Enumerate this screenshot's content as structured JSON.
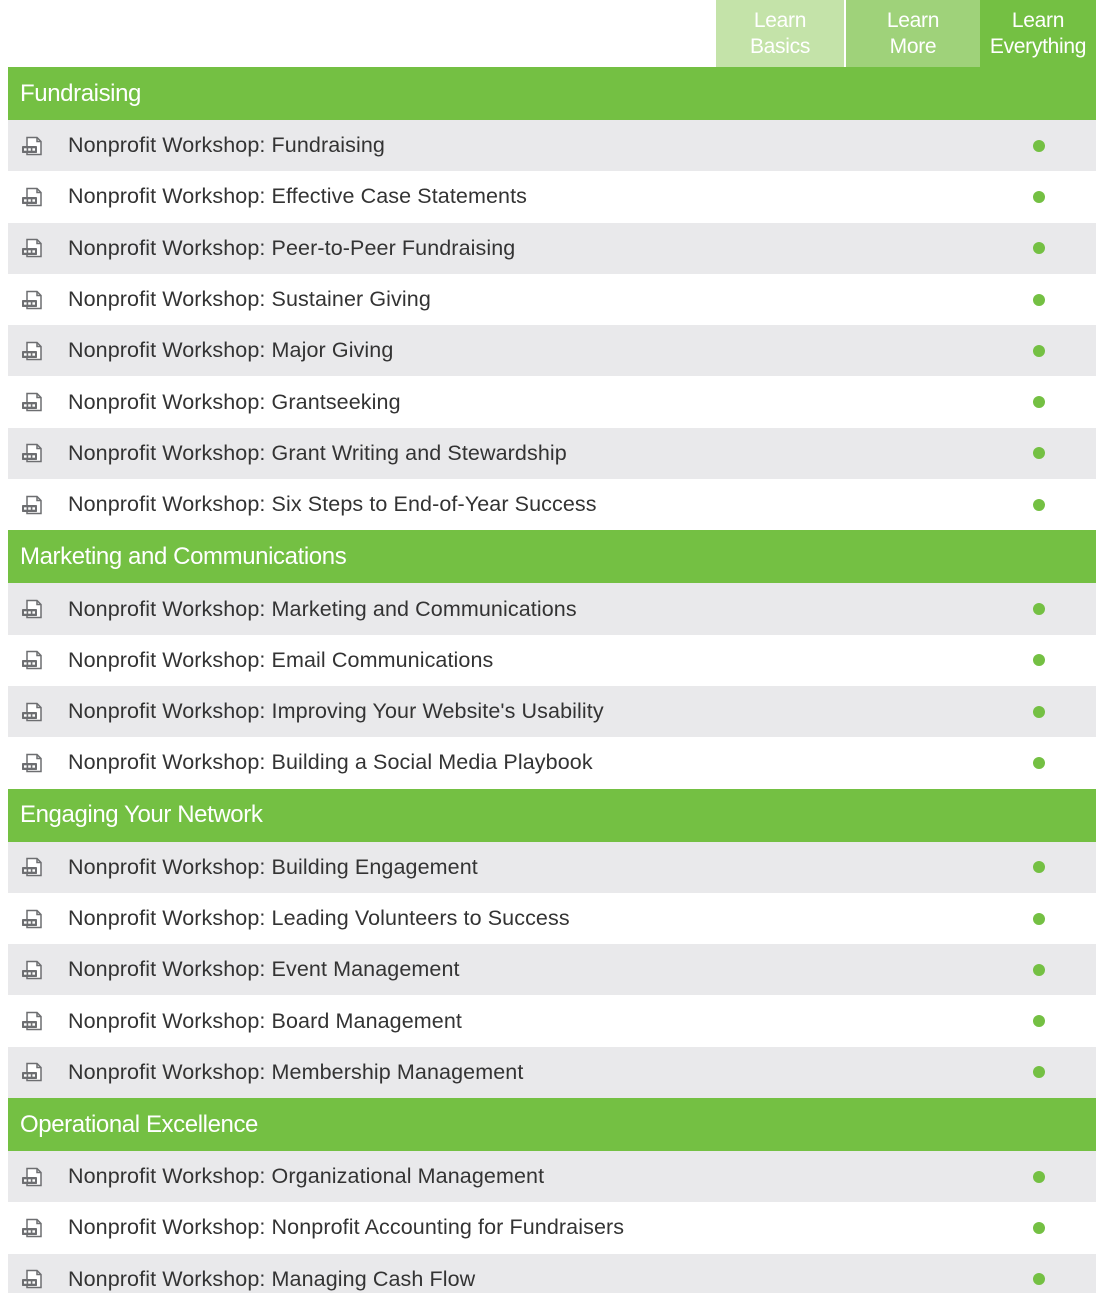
{
  "header": {
    "columns": [
      {
        "line1": "Learn",
        "line2": "Basics",
        "color": "#c4e3a9"
      },
      {
        "line1": "Learn",
        "line2": "More",
        "color": "#9fd27a"
      },
      {
        "line1": "Learn",
        "line2": "Everything",
        "color": "#74c043"
      }
    ]
  },
  "icon": "pdf-file-icon",
  "accent": "#74c043",
  "shade": "#e9e9eb",
  "sections": [
    {
      "title": "Fundraising",
      "rows": [
        {
          "title": "Nonprofit Workshop: Fundraising"
        },
        {
          "title": "Nonprofit Workshop: Effective Case Statements"
        },
        {
          "title": "Nonprofit Workshop: Peer-to-Peer Fundraising"
        },
        {
          "title": "Nonprofit Workshop: Sustainer Giving"
        },
        {
          "title": "Nonprofit Workshop: Major Giving"
        },
        {
          "title": "Nonprofit Workshop: Grantseeking"
        },
        {
          "title": "Nonprofit Workshop: Grant Writing and Stewardship"
        },
        {
          "title": "Nonprofit Workshop: Six Steps to End-of-Year Success"
        }
      ]
    },
    {
      "title": "Marketing and Communications",
      "rows": [
        {
          "title": "Nonprofit Workshop: Marketing and Communications"
        },
        {
          "title": "Nonprofit Workshop: Email Communications"
        },
        {
          "title": "Nonprofit Workshop: Improving Your Website's Usability"
        },
        {
          "title": "Nonprofit Workshop: Building a Social Media Playbook"
        }
      ]
    },
    {
      "title": "Engaging Your Network",
      "rows": [
        {
          "title": "Nonprofit Workshop: Building Engagement"
        },
        {
          "title": "Nonprofit Workshop: Leading Volunteers to Success"
        },
        {
          "title": "Nonprofit Workshop: Event Management"
        },
        {
          "title": "Nonprofit Workshop: Board Management"
        },
        {
          "title": "Nonprofit Workshop: Membership Management"
        }
      ]
    },
    {
      "title": "Operational Excellence",
      "rows": [
        {
          "title": "Nonprofit Workshop: Organizational Management"
        },
        {
          "title": "Nonprofit Workshop: Nonprofit Accounting for Fundraisers"
        },
        {
          "title": "Nonprofit Workshop: Managing Cash Flow"
        }
      ]
    }
  ]
}
